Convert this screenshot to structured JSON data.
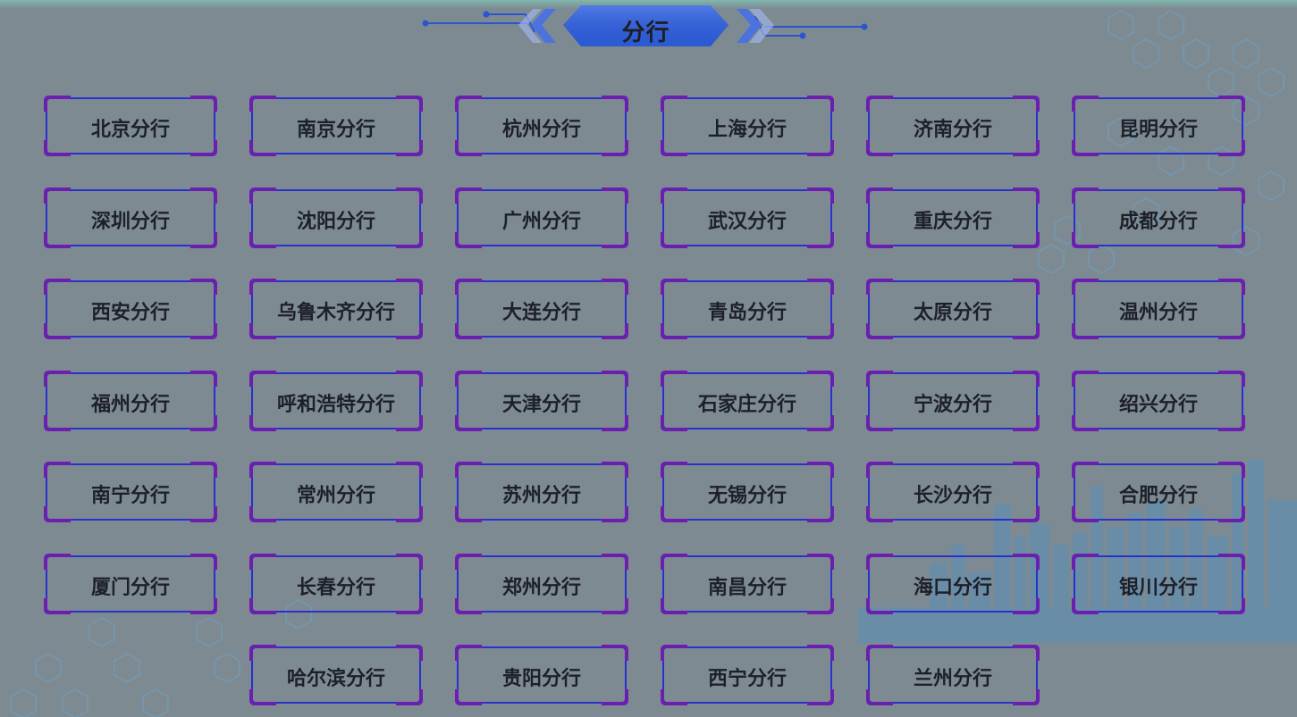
{
  "header": {
    "title": "分行"
  },
  "branches": [
    [
      "北京分行",
      "南京分行",
      "杭州分行",
      "上海分行",
      "济南分行",
      "昆明分行"
    ],
    [
      "深圳分行",
      "沈阳分行",
      "广州分行",
      "武汉分行",
      "重庆分行",
      "成都分行"
    ],
    [
      "西安分行",
      "乌鲁木齐分行",
      "大连分行",
      "青岛分行",
      "太原分行",
      "温州分行"
    ],
    [
      "福州分行",
      "呼和浩特分行",
      "天津分行",
      "石家庄分行",
      "宁波分行",
      "绍兴分行"
    ],
    [
      "南宁分行",
      "常州分行",
      "苏州分行",
      "无锡分行",
      "长沙分行",
      "合肥分行"
    ],
    [
      "厦门分行",
      "长春分行",
      "郑州分行",
      "南昌分行",
      "海口分行",
      "银川分行"
    ],
    [
      "哈尔滨分行",
      "贵阳分行",
      "西宁分行",
      "兰州分行"
    ]
  ],
  "colors": {
    "background": "#7e8a91",
    "button_border": "#2a2fcf",
    "button_corner": "#6a1fb0",
    "title_banner": "#2f5fd6",
    "text": "#1d2028"
  }
}
